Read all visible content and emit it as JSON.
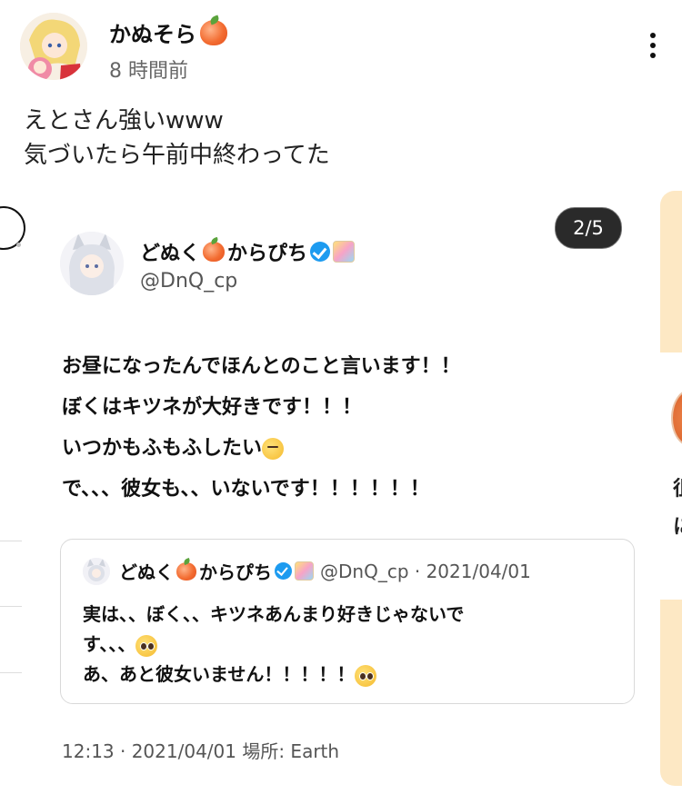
{
  "post": {
    "username": "かぬそら",
    "time": "8 時間前",
    "body_line1": "えとさん強いwww",
    "body_line2": "気づいたら午前中終わってた"
  },
  "carousel": {
    "indicator": "2/5"
  },
  "tweet": {
    "name_part1": "どぬく",
    "name_part2": "からぴち",
    "handle": "@DnQ_cp",
    "line1": "お昼になったんでほんとのこと言います！！",
    "line2": "ぼくはキツネが大好きです！！！",
    "line3": "いつかもふもふしたい",
    "line4": "で、、、彼女も、、いないです！！！！！！",
    "meta": "12:13 · 2021/04/01 場所: Earth",
    "quote": {
      "name_part1": "どぬく",
      "name_part2": "からぴち",
      "handle_date": "@DnQ_cp · 2021/04/01",
      "line1": "実は、、ぼく、、キツネあんまり好きじゃないで",
      "line2": "す、、、",
      "line3": "あ、あと彼女いません！！！！！"
    }
  },
  "right_card": {
    "char1": "徂",
    "char2": "に"
  }
}
